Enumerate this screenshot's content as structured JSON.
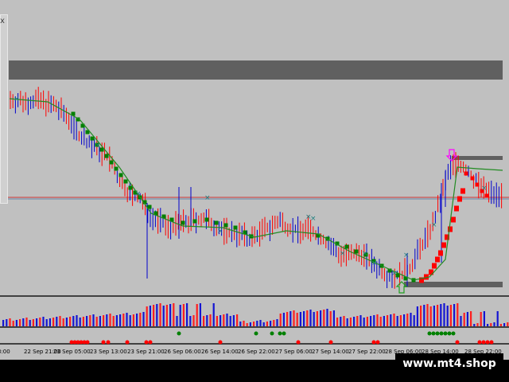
{
  "x_labels": [
    "3:00",
    "22 Sep 21:00",
    "23 Sep 05:00",
    "23 Sep 13:00",
    "23 Sep 21:00",
    "26 Sep 06:00",
    "26 Sep 14:00",
    "26 Sep 22:00",
    "27 Sep 06:00",
    "27 Sep 14:00",
    "27 Sep 22:00",
    "28 Sep 06:00",
    "28 Sep 14:00",
    "28 Sep 22:00"
  ],
  "watermark": "www.mt4.shop",
  "panel_close_glyph": "x",
  "colors": {
    "background": "#c0c0c0",
    "bull_candle": "#0000cc",
    "bear_candle": "#ff0000",
    "trend_up": "#008000",
    "trend_down": "#ff0000",
    "histogram_up": "#1414d2",
    "histogram_down": "#ff1e1e",
    "level_bar": "#606060",
    "horizontal_line": "#cc3333",
    "signal_cross": "#208080",
    "signal_arrow": "#ff00ff"
  },
  "icons": {
    "signal_arrow_up": "arrow-up-icon",
    "signal_arrow_down": "arrow-down-icon",
    "cross_marker": "cross-icon"
  }
}
